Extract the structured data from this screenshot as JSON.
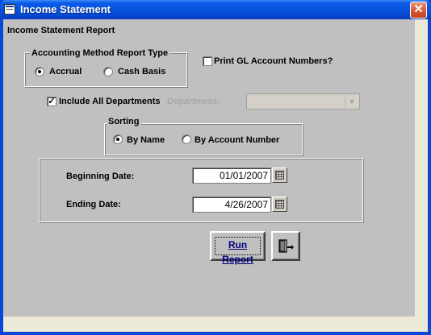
{
  "window": {
    "title": "Income Statement",
    "close_glyph": "✕"
  },
  "form": {
    "heading": "Income Statement  Report",
    "method_group": {
      "label": "Accounting Method Report Type",
      "options": [
        "Accrual",
        "Cash Basis"
      ],
      "selected": "Accrual"
    },
    "print_gl": {
      "label": "Print GL Account Numbers?",
      "checked": false
    },
    "include_all_depts": {
      "label": "Include All Departments",
      "checked": true
    },
    "department": {
      "label": "Department:",
      "value": ""
    },
    "sorting_group": {
      "label": "Sorting",
      "options": [
        "By Name",
        "By Account Number"
      ],
      "selected": "By Name"
    },
    "dates": {
      "begin_label": "Beginning Date:",
      "begin_value": "01/01/2007",
      "end_label": "Ending Date:",
      "end_value": "4/26/2007"
    },
    "run_button": "Run Report",
    "exit_icon": "exit-door-icon"
  },
  "colors": {
    "titlebar": "#0652dd",
    "form_bg": "#c0c0c0",
    "run_label": "#000080"
  }
}
